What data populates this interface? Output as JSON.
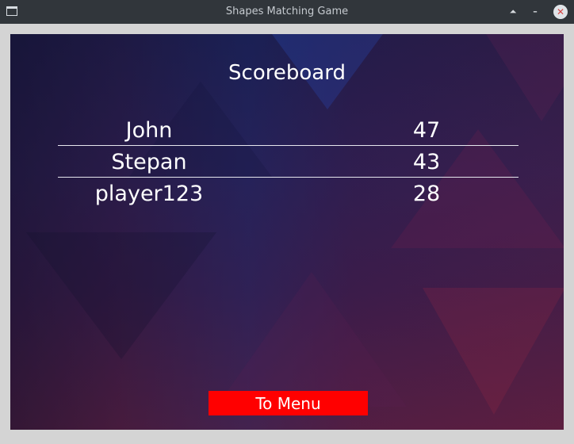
{
  "window": {
    "title": "Shapes Matching Game",
    "buttons": {
      "keep_above": "⏶",
      "minimize": "–",
      "close": "✕"
    }
  },
  "scoreboard": {
    "title": "Scoreboard",
    "entries": [
      {
        "name": "John",
        "score": "47"
      },
      {
        "name": "Stepan",
        "score": "43"
      },
      {
        "name": "player123",
        "score": "28"
      }
    ]
  },
  "actions": {
    "to_menu_label": "To Menu"
  },
  "colors": {
    "button_bg": "#ff0000",
    "titlebar_bg": "#31363b"
  }
}
